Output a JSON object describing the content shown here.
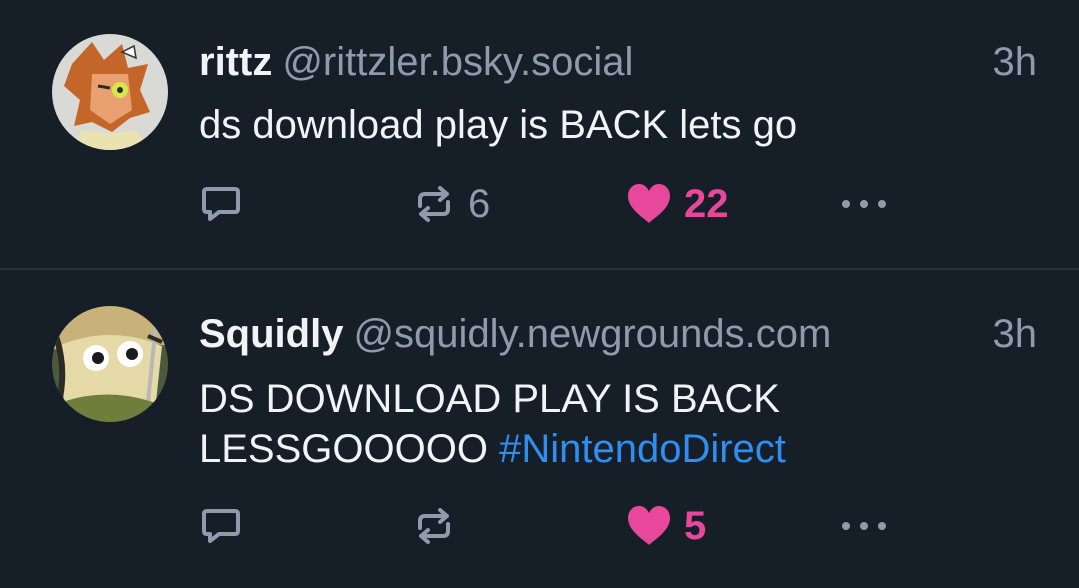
{
  "colors": {
    "background": "#161e27",
    "text": "#f1f3f5",
    "muted": "#8e9bae",
    "like": "#e8489b",
    "hashtag": "#2f8ef0",
    "divider": "#26313d"
  },
  "posts": [
    {
      "author": "rittz",
      "handle": "@rittzler.bsky.social",
      "time": "3h",
      "text_lines": [
        "ds download play is BACK lets go"
      ],
      "hashtag": "",
      "reposts": "6",
      "likes": "22",
      "liked": true,
      "icons": {
        "reply": "reply-icon",
        "repost": "repost-icon",
        "like": "heart-icon",
        "more": "more-icon"
      }
    },
    {
      "author": "Squidly",
      "handle": "@squidly.newgrounds.com",
      "time": "3h",
      "text_lines": [
        "DS DOWNLOAD PLAY IS BACK",
        "LESSGOOOOO"
      ],
      "hashtag": "#NintendoDirect",
      "reposts": "",
      "likes": "5",
      "liked": true,
      "icons": {
        "reply": "reply-icon",
        "repost": "repost-icon",
        "like": "heart-icon",
        "more": "more-icon"
      }
    }
  ]
}
